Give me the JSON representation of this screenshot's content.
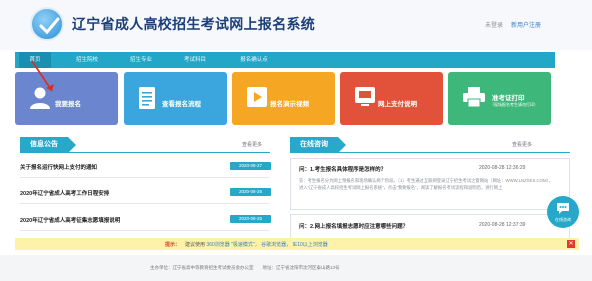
{
  "header": {
    "title": "辽宁省成人高校招生考试网上报名系统",
    "login_status": "未登录",
    "register_link": "新用户注册"
  },
  "nav": {
    "items": [
      "首页",
      "招生院校",
      "招生专业",
      "考试科目",
      "报名确认点"
    ]
  },
  "tiles": [
    {
      "label": "我要报名",
      "icon": "user-icon",
      "color": "#6b86cf"
    },
    {
      "label": "查看报名流程",
      "icon": "document-icon",
      "color": "#3aa6dd"
    },
    {
      "label": "报名演示视频",
      "icon": "video-icon",
      "color": "#f5a623"
    },
    {
      "label": "网上支付说明",
      "icon": "card-icon",
      "color": "#e2523b"
    },
    {
      "label": "准考证打印",
      "sub": "（现场报名考生请勿打印）",
      "icon": "printer-icon",
      "color": "#3db77a"
    }
  ],
  "notices": {
    "title": "信息公告",
    "more": "查看更多",
    "items": [
      {
        "title": "关于报名运行快网上支付的通知",
        "date": "2020-08-27"
      },
      {
        "title": "2020年辽宁省成人高考工作日程安排",
        "date": "2020-08-25"
      },
      {
        "title": "2020年辽宁省成人高考征集志愿填报说明",
        "date": "2020-08-25"
      }
    ]
  },
  "qa": {
    "title": "在线咨询",
    "more": "查看更多",
    "items": [
      {
        "question": "问：1.考生报名具体程序是怎样的？",
        "date": "2020-08-28 12:36:29",
        "answer": "答：考生报名分为网上预报名和现场确认两个阶段。（1）考生通过互联网登录辽宁招生考试之窗网站（网址：WWW.LNZSKS.COM），进入“辽宁省成人高校招生考试网上报名系统”，点击“我要报名”，阅读了解报名考试流程和说明后，进行网上"
      },
      {
        "question": "问：2.网上报名填报志愿时应注意哪些问题？",
        "date": "2020-08-28 12:37:39",
        "answer": ""
      }
    ]
  },
  "tipbar": {
    "label": "提示：",
    "text_prefix": "建议使用",
    "browser1": "360浏览器",
    "browser1_mode": "\"极速模式\"，",
    "browser2": "谷歌浏览器，",
    "browser3": "IE10以上浏览器",
    "close": "✕"
  },
  "footer": {
    "text": "主办单位：辽宁省高中等教育招生考试委员会办公室　　地址：辽宁省沈阳市沈河区泰山路13号"
  },
  "chat_fab": {
    "label": "在线咨询"
  }
}
